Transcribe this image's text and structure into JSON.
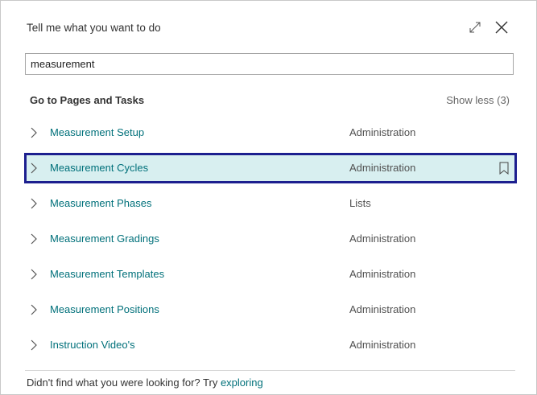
{
  "dialog": {
    "title": "Tell me what you want to do"
  },
  "search": {
    "value": "measurement"
  },
  "section": {
    "title": "Go to Pages and Tasks",
    "show_less": "Show less (3)"
  },
  "results": [
    {
      "name": "Measurement Setup",
      "category": "Administration"
    },
    {
      "name": "Measurement Cycles",
      "category": "Administration"
    },
    {
      "name": "Measurement Phases",
      "category": "Lists"
    },
    {
      "name": "Measurement Gradings",
      "category": "Administration"
    },
    {
      "name": "Measurement Templates",
      "category": "Administration"
    },
    {
      "name": "Measurement Positions",
      "category": "Administration"
    },
    {
      "name": "Instruction Video's",
      "category": "Administration"
    }
  ],
  "selected_index": 1,
  "footer": {
    "text": "Didn't find what you were looking for? Try ",
    "link": "exploring"
  },
  "colors": {
    "accent": "#00707a",
    "selection_border": "#1c1f8f",
    "selection_fill": "#d8eff0"
  },
  "icons": {
    "expand": "expand-icon",
    "close": "close-icon",
    "chevron": "chevron-right-icon",
    "bookmark": "bookmark-icon"
  }
}
